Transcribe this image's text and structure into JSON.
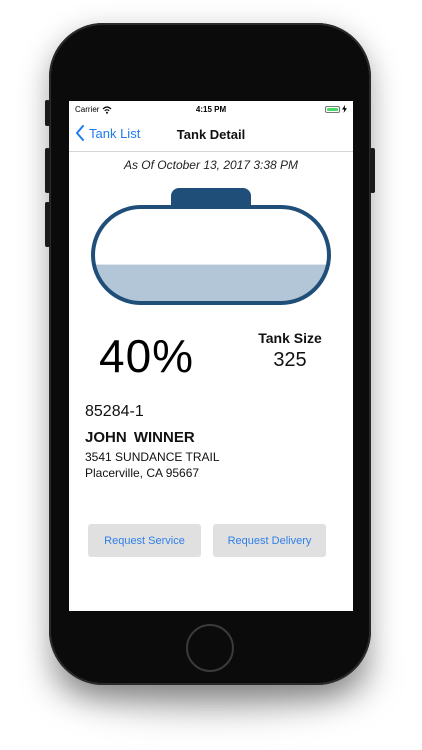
{
  "status_bar": {
    "carrier": "Carrier",
    "time": "4:15 PM"
  },
  "nav": {
    "back_label": "Tank List",
    "title": "Tank Detail"
  },
  "as_of": "As Of  October 13, 2017 3:38 PM",
  "tank": {
    "fill_level": 0.4,
    "outline_color": "#1f4e79",
    "fill_color": "#b2c6d8"
  },
  "percent_label": "40%",
  "tank_size": {
    "label": "Tank Size",
    "value": "325"
  },
  "customer": {
    "account": "85284-1",
    "name": "JOHN  WINNER",
    "address_line1": "3541 SUNDANCE TRAIL",
    "address_line2": "Placerville, CA 95667"
  },
  "actions": {
    "service_label": "Request Service",
    "delivery_label": "Request Delivery"
  },
  "colors": {
    "accent": "#1e7bf0"
  }
}
